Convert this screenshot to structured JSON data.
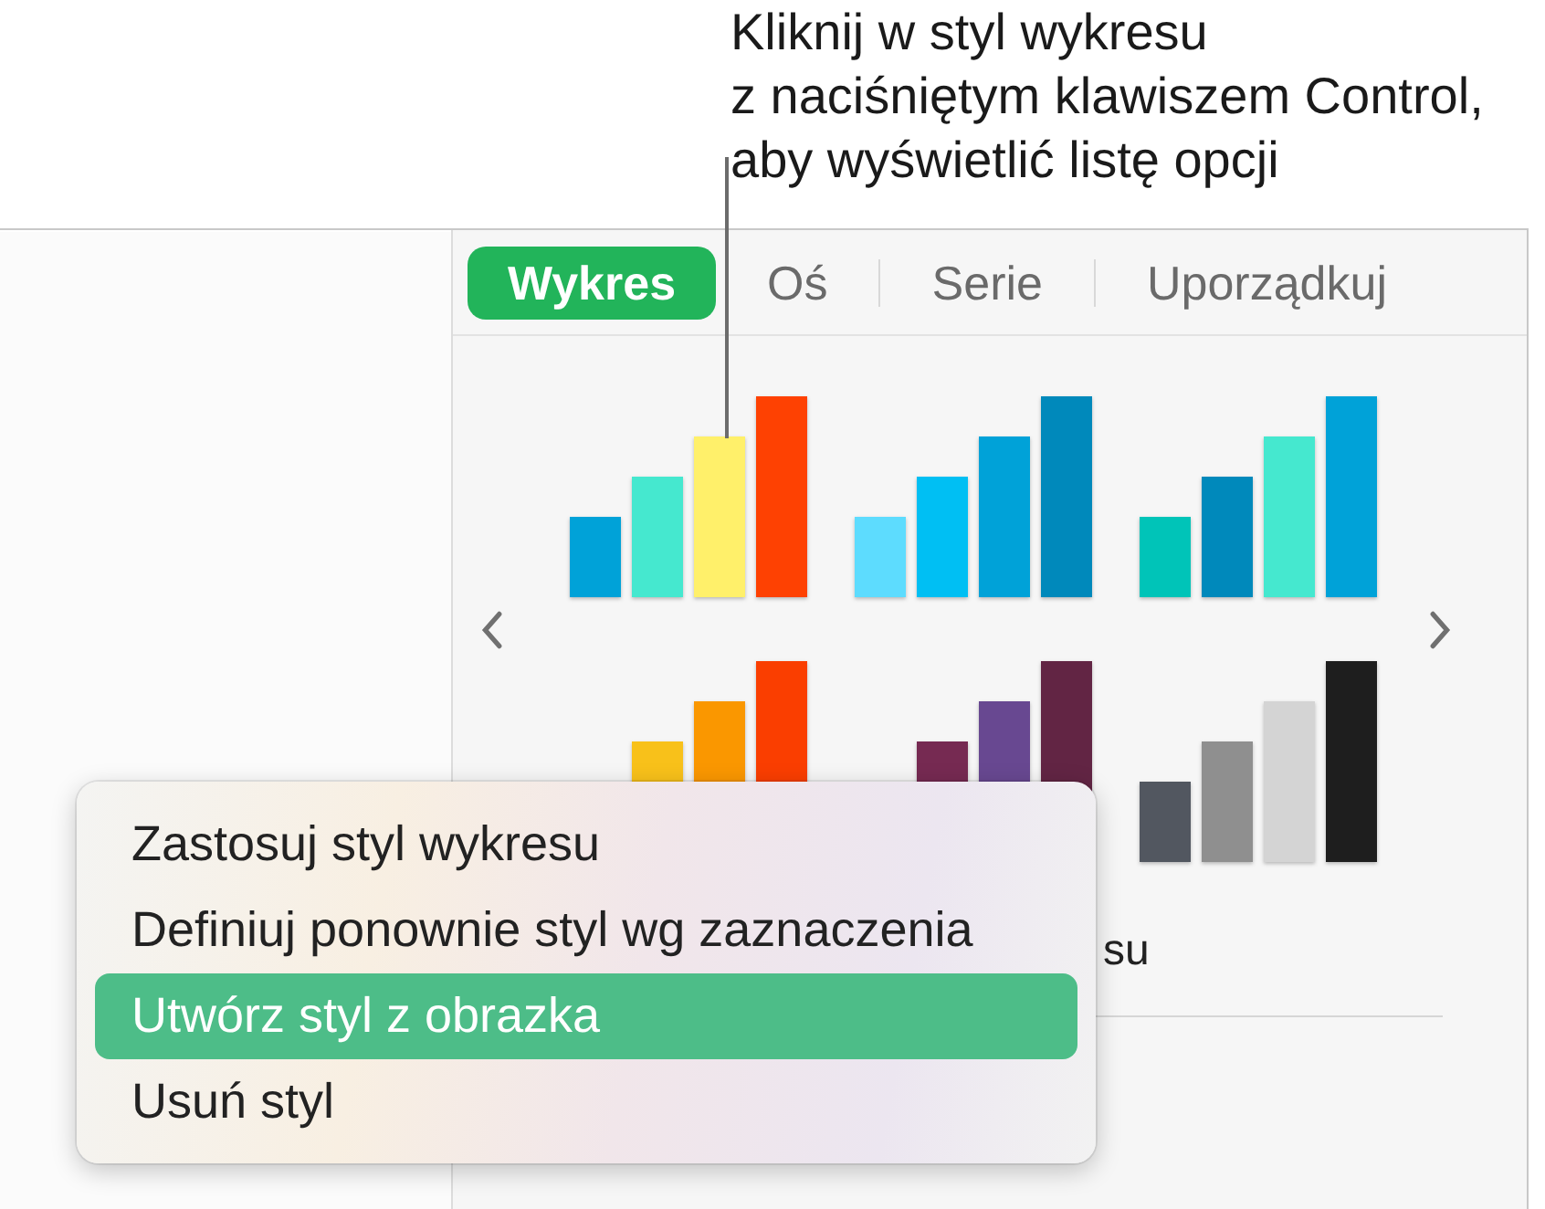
{
  "callout": {
    "text": "Kliknij w styl wykresu\nz naciśniętym klawiszem Control,\naby wyświetlić listę opcji"
  },
  "tabs": [
    {
      "label": "Wykres",
      "selected": true
    },
    {
      "label": "Oś",
      "selected": false
    },
    {
      "label": "Serie",
      "selected": false
    },
    {
      "label": "Uporządkuj",
      "selected": false
    }
  ],
  "styles": [
    {
      "bars": [
        {
          "color": "#00a2d8"
        },
        {
          "color": "#45e8cf"
        },
        {
          "color": "#fff06a"
        },
        {
          "color": "#fe4102"
        }
      ]
    },
    {
      "bars": [
        {
          "color": "#5ddcfe"
        },
        {
          "color": "#00bff3"
        },
        {
          "color": "#00a2d8"
        },
        {
          "color": "#0089bb"
        }
      ]
    },
    {
      "bars": [
        {
          "color": "#00c4b8"
        },
        {
          "color": "#0089bb"
        },
        {
          "color": "#45e8cf"
        },
        {
          "color": "#00a2d8"
        }
      ]
    },
    {
      "bars": [
        {
          "color": "#f8c11a"
        },
        {
          "color": "#fa9700"
        },
        {
          "color": "#fa3e00"
        }
      ]
    },
    {
      "bars": [
        {
          "color": "#762a52"
        },
        {
          "color": "#684891"
        },
        {
          "color": "#622544"
        }
      ]
    },
    {
      "bars": [
        {
          "color": "#525760"
        },
        {
          "color": "#8f8f8f"
        },
        {
          "color": "#d4d4d4"
        },
        {
          "color": "#1e1e1e"
        }
      ]
    }
  ],
  "caption": "su",
  "menu": [
    {
      "label": "Zastosuj styl wykresu",
      "selected": false
    },
    {
      "label": "Definiuj ponownie styl wg zaznaczenia",
      "selected": false
    },
    {
      "label": "Utwórz styl z obrazka",
      "selected": true
    },
    {
      "label": "Usuń styl",
      "selected": false
    }
  ]
}
